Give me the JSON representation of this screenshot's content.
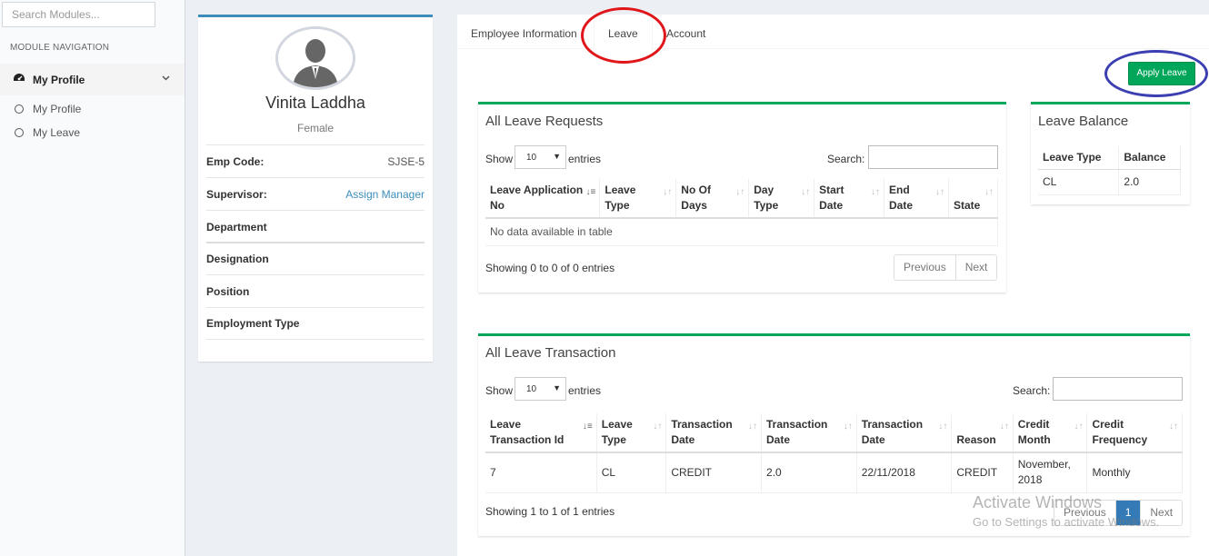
{
  "sidebar": {
    "search_placeholder": "Search Modules...",
    "header": "MODULE NAVIGATION",
    "main_item": "My Profile",
    "sub_items": [
      "My Profile",
      "My Leave"
    ]
  },
  "profile": {
    "name": "Vinita Laddha",
    "gender": "Female",
    "rows": [
      {
        "label": "Emp Code:",
        "value": "SJSE-5"
      },
      {
        "label": "Supervisor:",
        "value": "Assign Manager"
      },
      {
        "label": "Department",
        "value": ""
      },
      {
        "label": "Designation",
        "value": ""
      },
      {
        "label": "Position",
        "value": ""
      },
      {
        "label": "Employment Type",
        "value": ""
      }
    ]
  },
  "tabs": [
    "Employee Information",
    "Leave",
    "Account"
  ],
  "apply_leave": "Apply Leave",
  "requests": {
    "title": "All Leave Requests",
    "show": "Show",
    "entries_value": "10",
    "entries": "entries",
    "search": "Search:",
    "headers": [
      [
        "Leave Application",
        "No"
      ],
      [
        "Leave",
        "Type"
      ],
      [
        "No Of",
        "Days"
      ],
      [
        "Day",
        "Type"
      ],
      [
        "Start",
        "Date"
      ],
      [
        "End",
        "Date"
      ],
      [
        "",
        "State"
      ]
    ],
    "empty": "No data available in table",
    "info": "Showing 0 to 0 of 0 entries",
    "prev": "Previous",
    "next": "Next"
  },
  "balance": {
    "title": "Leave Balance",
    "headers": [
      "Leave Type",
      "Balance"
    ],
    "rows": [
      [
        "CL",
        "2.0"
      ]
    ]
  },
  "transactions": {
    "title": "All Leave Transaction",
    "show": "Show",
    "entries_value": "10",
    "entries": "entries",
    "search": "Search:",
    "headers": [
      [
        "Leave",
        "Transaction Id"
      ],
      [
        "Leave",
        "Type"
      ],
      [
        "Transaction",
        "Date"
      ],
      [
        "Transaction",
        "Date"
      ],
      [
        "Transaction",
        "Date"
      ],
      [
        "",
        "Reason"
      ],
      [
        "Credit",
        "Month"
      ],
      [
        "Credit",
        "Frequency"
      ]
    ],
    "rows": [
      [
        "7",
        "CL",
        "CREDIT",
        "2.0",
        "22/11/2018",
        "CREDIT",
        "November, 2018",
        "Monthly"
      ]
    ],
    "info": "Showing 1 to 1 of 1 entries",
    "prev": "Previous",
    "page": "1",
    "next": "Next"
  },
  "watermark": {
    "line1": "Activate Windows",
    "line2": "Go to Settings to activate Windows."
  }
}
